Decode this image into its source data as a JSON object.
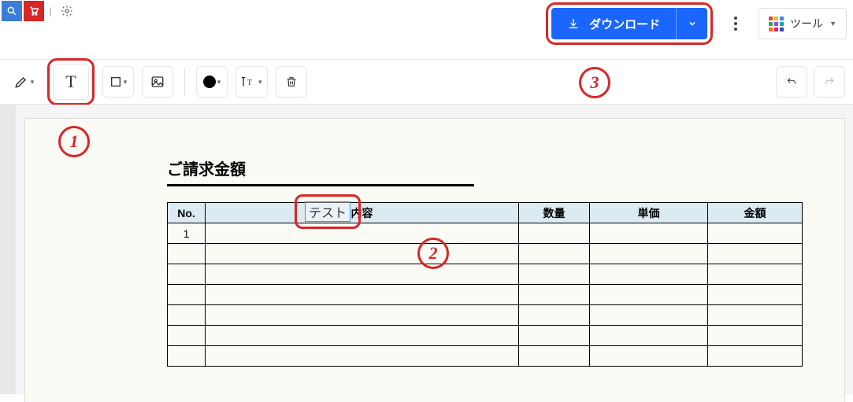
{
  "header": {
    "download_label": "ダウンロード",
    "tools_label": "ツール"
  },
  "toolbar": {
    "text_tool_glyph": "T"
  },
  "document": {
    "title": "ご請求金額",
    "columns": {
      "no": "No.",
      "description": "内容",
      "quantity": "数量",
      "unit_price": "単価",
      "amount": "金額"
    },
    "rows": [
      {
        "no": "1",
        "description": "",
        "quantity": "",
        "unit_price": "",
        "amount": ""
      },
      {
        "no": "",
        "description": "",
        "quantity": "",
        "unit_price": "",
        "amount": ""
      },
      {
        "no": "",
        "description": "",
        "quantity": "",
        "unit_price": "",
        "amount": ""
      },
      {
        "no": "",
        "description": "",
        "quantity": "",
        "unit_price": "",
        "amount": ""
      },
      {
        "no": "",
        "description": "",
        "quantity": "",
        "unit_price": "",
        "amount": ""
      },
      {
        "no": "",
        "description": "",
        "quantity": "",
        "unit_price": "",
        "amount": ""
      },
      {
        "no": "",
        "description": "",
        "quantity": "",
        "unit_price": "",
        "amount": ""
      }
    ],
    "text_annotation": "テスト"
  },
  "badges": {
    "one": "1",
    "two": "2",
    "three": "3"
  }
}
